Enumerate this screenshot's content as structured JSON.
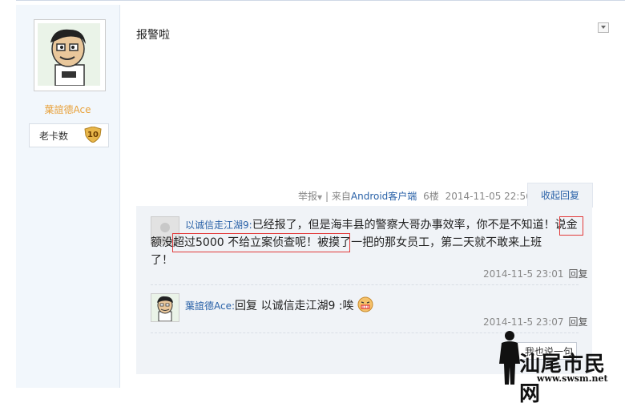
{
  "post": {
    "author": {
      "name": "葉誼德Ace",
      "badge_label": "老卡数",
      "badge_level": "10"
    },
    "text": "报警啦",
    "meta": {
      "report": "举报",
      "separator": "|",
      "source_prefix": "来自",
      "source_app": "Android客户端",
      "floor": "6楼",
      "time": "2014-11-05 22:56",
      "collapse_label": "收起回复"
    }
  },
  "replies": [
    {
      "user": "以诚信走江湖9",
      "colon": ":",
      "line1": "已经报了，但是海丰县的警察大哥办事效率，你不是不知道！说金",
      "line2": "额没超过5000 不给立案侦查呢！被摸了一把的那女员工，第二天就不敢来上班",
      "line3": "了！",
      "time": "2014-11-5 23:01",
      "reply_label": "回复"
    },
    {
      "user": "葉誼德Ace",
      "colon": ":",
      "text": "回复 以诚信走江湖9 :唉",
      "time": "2014-11-5 23:07",
      "reply_label": "回复"
    }
  ],
  "say_button": "我也说一句",
  "watermark": {
    "text": "汕尾市民网",
    "url": "www.swsm.net"
  },
  "colors": {
    "accent": "#2a62a8",
    "username": "#e8a13a",
    "highlight": "#e23a3a"
  }
}
